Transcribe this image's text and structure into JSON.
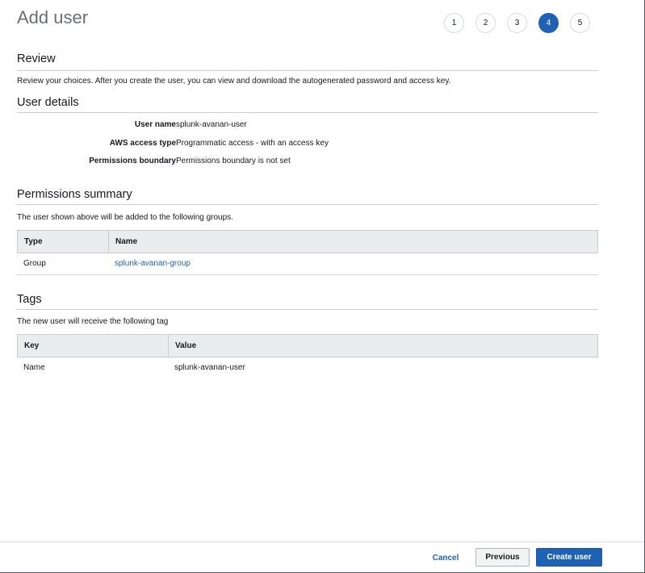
{
  "header": {
    "title": "Add user",
    "steps": [
      "1",
      "2",
      "3",
      "4",
      "5"
    ],
    "active_step": "4"
  },
  "review": {
    "title": "Review",
    "description": "Review your choices. After you create the user, you can view and download the autogenerated password and access key."
  },
  "user_details": {
    "title": "User details",
    "rows": [
      {
        "label": "User name",
        "value": "splunk-avanan-user"
      },
      {
        "label": "AWS access type",
        "value": "Programmatic access - with an access key"
      },
      {
        "label": "Permissions boundary",
        "value": "Permissions boundary is not set"
      }
    ]
  },
  "permissions_summary": {
    "title": "Permissions summary",
    "description": "The user shown above will be added to the following groups.",
    "columns": [
      "Type",
      "Name"
    ],
    "rows": [
      {
        "type": "Group",
        "name": "splunk-avanan-group"
      }
    ]
  },
  "tags": {
    "title": "Tags",
    "description": "The new user will receive the following tag",
    "columns": [
      "Key",
      "Value"
    ],
    "rows": [
      {
        "key": "Name",
        "value": "splunk-avanan-user"
      }
    ]
  },
  "footer": {
    "cancel_label": "Cancel",
    "previous_label": "Previous",
    "create_label": "Create user"
  },
  "colors": {
    "accent": "#1f62b5",
    "header_bg": "#eaeded",
    "title_gray": "#6b6e73"
  }
}
